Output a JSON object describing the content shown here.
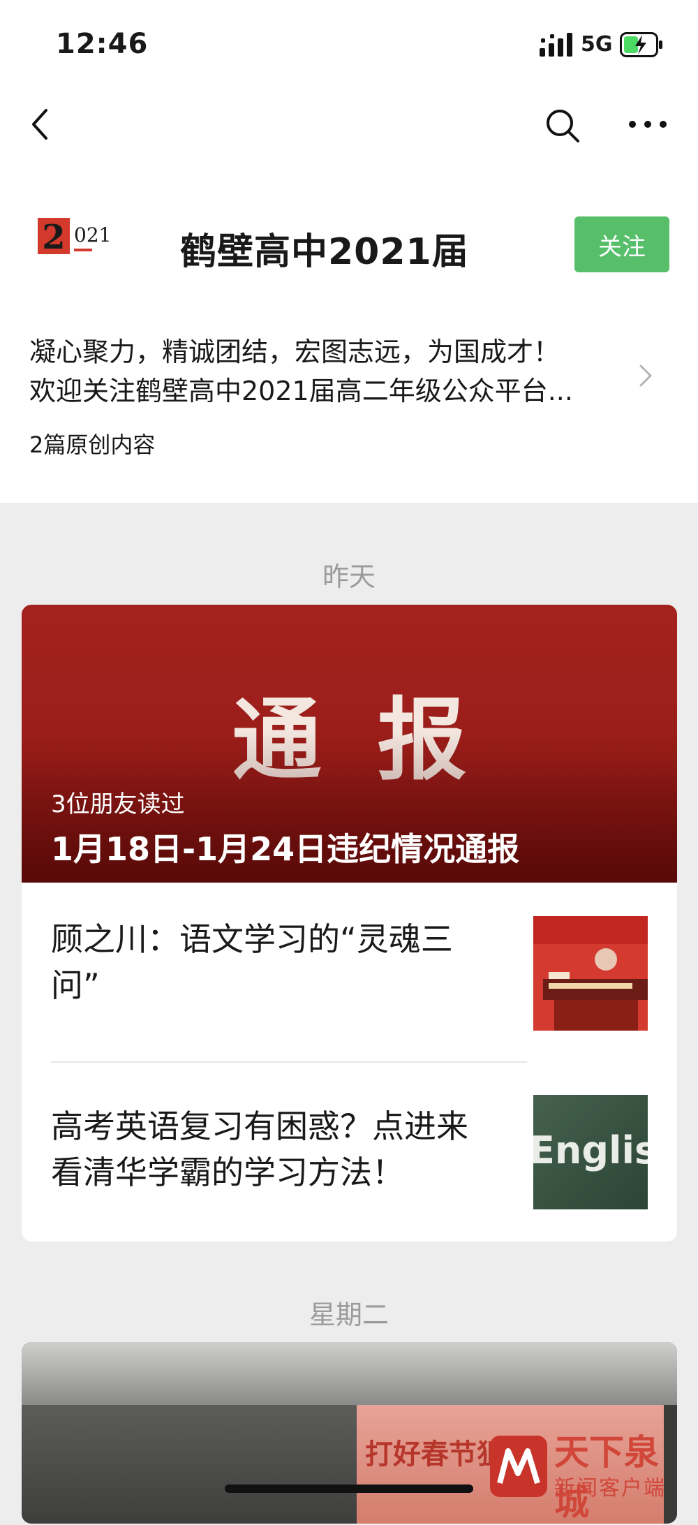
{
  "status_bar": {
    "time": "12:46",
    "network": "5G"
  },
  "account": {
    "name": "鹤壁高中2021届",
    "logo_text": "2021",
    "follow_label": "关注",
    "description_lines": [
      "凝心聚力，精诚团结，宏图志远，为国成才！",
      "欢迎关注鹤壁高中2021届高二年级公众平台..."
    ],
    "original_count": "2篇原创内容"
  },
  "feed": {
    "groups": [
      {
        "date": "昨天",
        "lead": {
          "cover_text": "通报",
          "friends_read": "3位朋友读过",
          "title": "1月18日-1月24日违纪情况通报"
        },
        "items": [
          {
            "title": "顾之川：语文学习的“灵魂三问”",
            "thumb_icon": "lecture-photo"
          },
          {
            "title": "高考英语复习有困惑？点进来看清华学霸的学习方法！",
            "thumb_icon": "english-chalkboard",
            "thumb_text": "English"
          }
        ]
      },
      {
        "date": "星期二",
        "lead": {
          "cover_text": "打好春节狙"
        }
      }
    ]
  },
  "watermark": {
    "line1": "天下泉城",
    "line2": "新闻客户端"
  },
  "colors": {
    "follow": "#57be6a",
    "cover_red": "#9a1d19",
    "background": "#ededed"
  }
}
